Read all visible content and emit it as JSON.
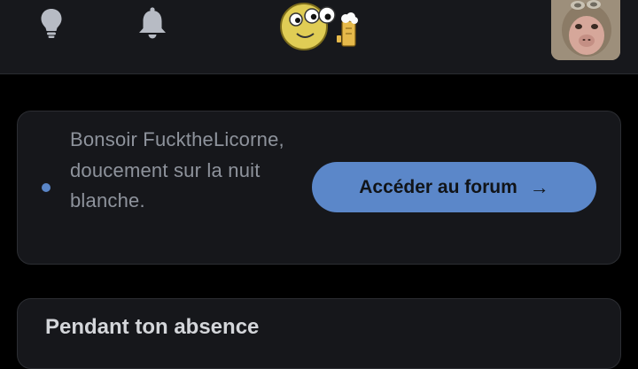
{
  "header": {
    "icons": {
      "tips": "lightbulb-icon",
      "notifications": "bell-icon",
      "mascot": "mascot-emoji",
      "avatar": "user-avatar"
    }
  },
  "greeting": {
    "message": "Bonsoir FucktheLicorne, doucement sur la nuit blanche.",
    "button_label": "Accéder au forum",
    "button_arrow": "→"
  },
  "absence": {
    "title": "Pendant ton absence"
  },
  "colors": {
    "accent": "#5b87c9",
    "topbar_bg": "#17181c",
    "card_bg": "#16171b",
    "page_bg": "#000000"
  }
}
